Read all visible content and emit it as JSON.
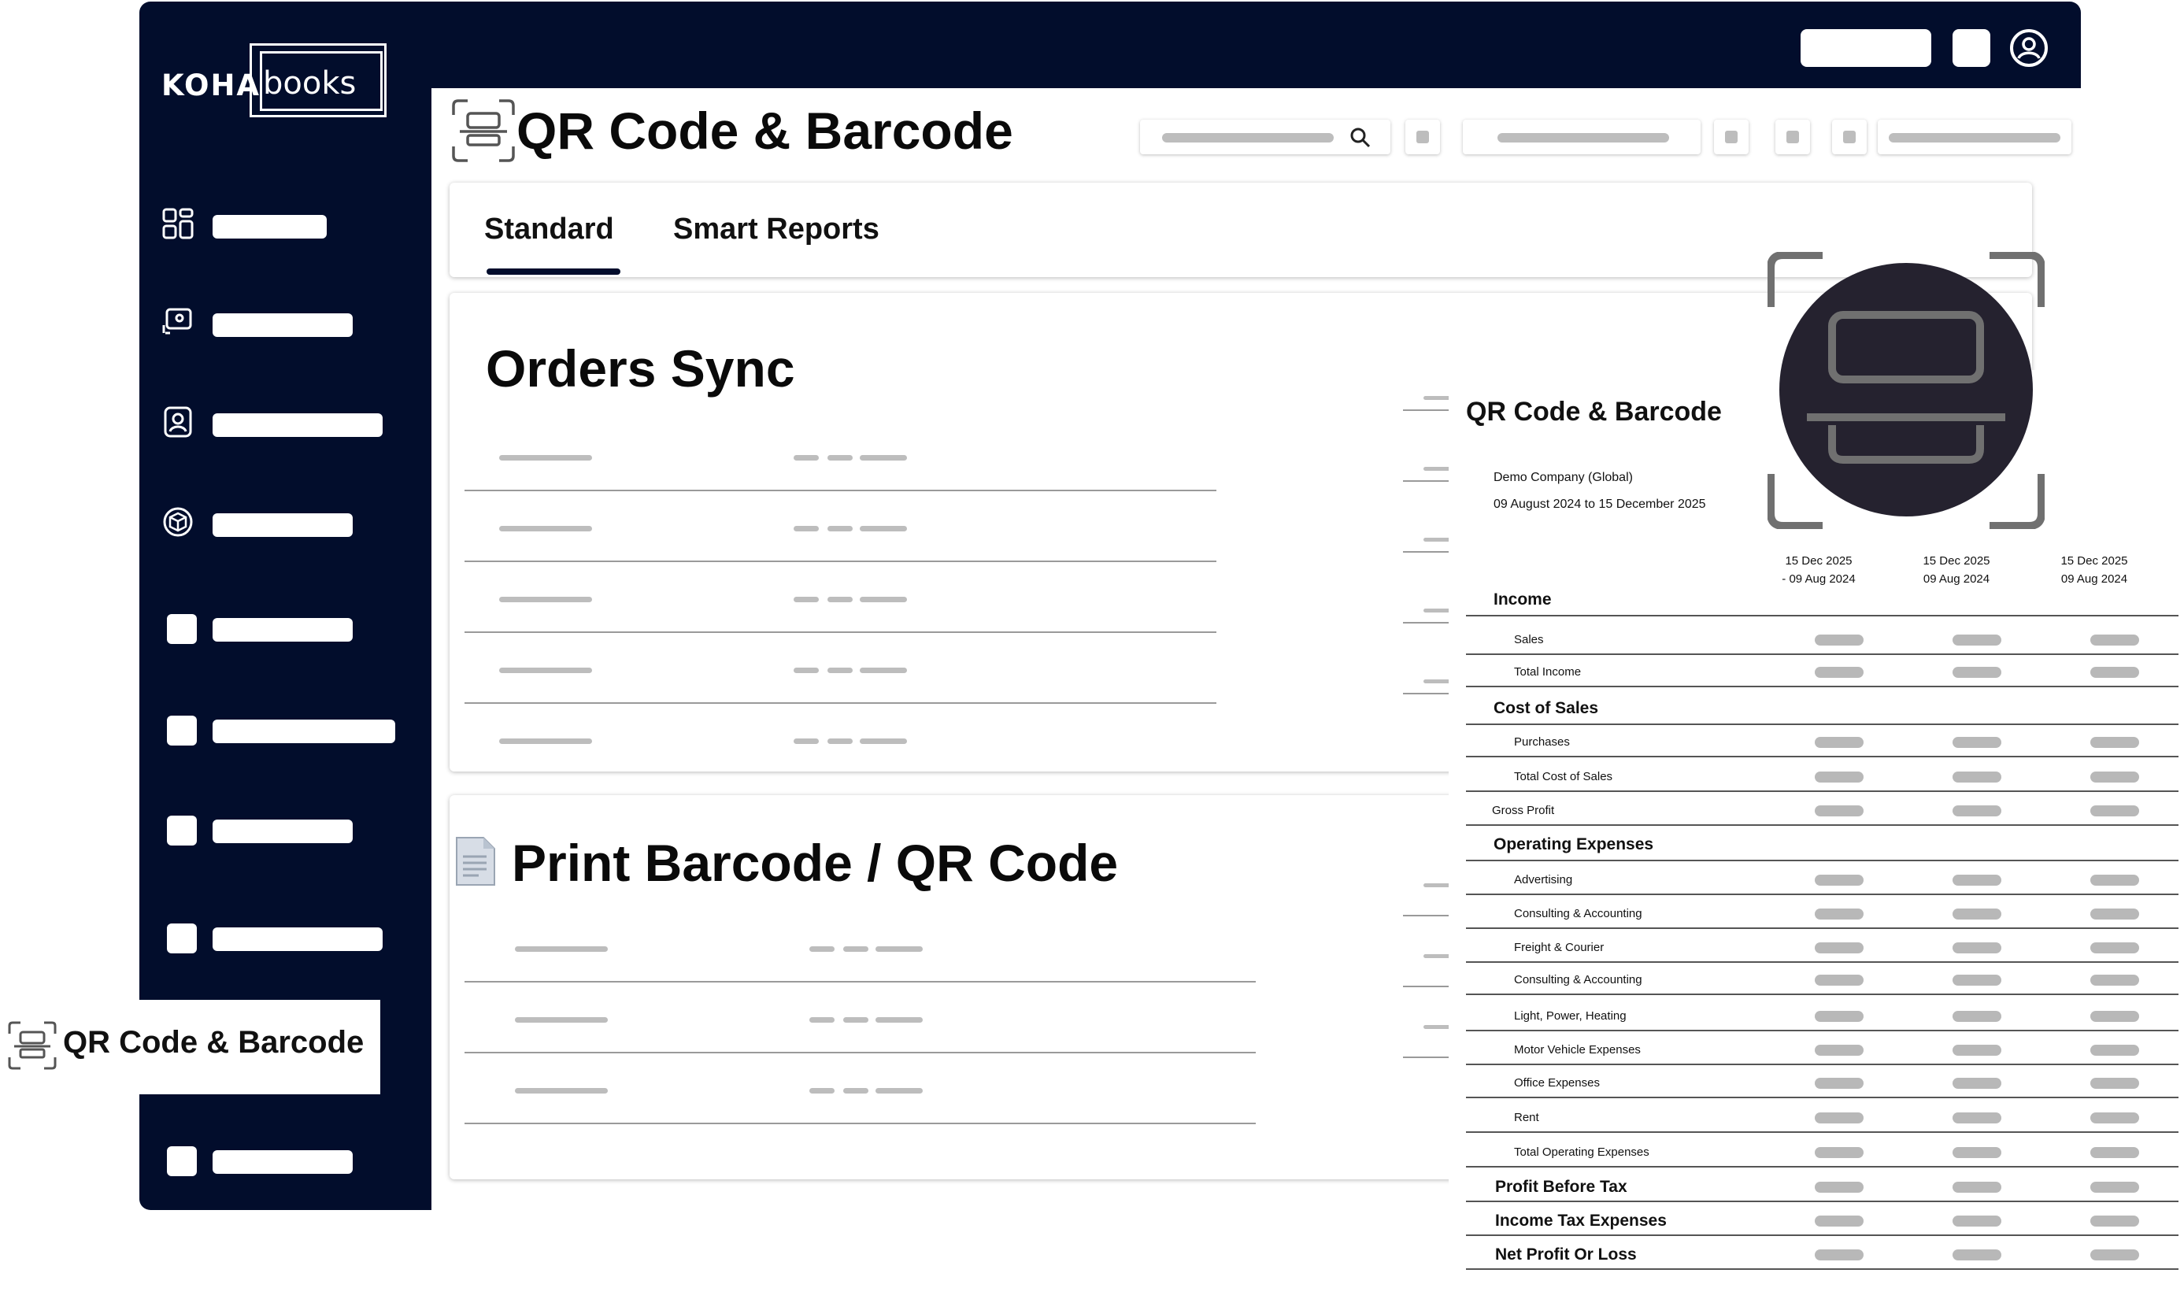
{
  "brand": {
    "logo_left": "KOHA",
    "logo_right": "books"
  },
  "header": {
    "page_title": "QR Code & Barcode"
  },
  "tabs": [
    {
      "label": "Standard",
      "active": true
    },
    {
      "label": "Smart Reports",
      "active": false
    }
  ],
  "sections": {
    "orders_sync": {
      "title": "Orders Sync"
    },
    "print_barcode": {
      "title": "Print Barcode / QR Code"
    }
  },
  "sidebar": {
    "active_label": "QR Code & Barcode"
  },
  "report": {
    "title": "QR Code & Barcode",
    "company": "Demo Company (Global)",
    "period": "09 August 2024 to 15 December 2025",
    "columns": [
      {
        "line1": "15 Dec 2025",
        "line2": "- 09 Aug 2024"
      },
      {
        "line1": "15 Dec 2025",
        "line2": "09 Aug 2024"
      },
      {
        "line1": "15 Dec 2025",
        "line2": "09 Aug 2024"
      }
    ],
    "rows": [
      {
        "label": "Income",
        "kind": "heading"
      },
      {
        "label": "Sales",
        "kind": "item"
      },
      {
        "label": "Total Income",
        "kind": "item"
      },
      {
        "label": "Cost of Sales",
        "kind": "heading"
      },
      {
        "label": "Purchases",
        "kind": "item"
      },
      {
        "label": "Total Cost of Sales",
        "kind": "item"
      },
      {
        "label": "Gross Profit",
        "kind": "plain"
      },
      {
        "label": "Operating Expenses",
        "kind": "heading"
      },
      {
        "label": "Advertising",
        "kind": "item"
      },
      {
        "label": "Consulting & Accounting",
        "kind": "item"
      },
      {
        "label": "Freight & Courier",
        "kind": "item"
      },
      {
        "label": "Consulting & Accounting",
        "kind": "item"
      },
      {
        "label": "Light, Power, Heating",
        "kind": "item"
      },
      {
        "label": "Motor Vehicle Expenses",
        "kind": "item"
      },
      {
        "label": "Office Expenses",
        "kind": "item"
      },
      {
        "label": "Rent",
        "kind": "item"
      },
      {
        "label": "Total Operating Expenses",
        "kind": "item"
      },
      {
        "label": "Profit Before Tax",
        "kind": "total"
      },
      {
        "label": "Income Tax Expenses",
        "kind": "total"
      },
      {
        "label": "Net Profit Or Loss",
        "kind": "total"
      }
    ]
  },
  "icons": {
    "sidebar": [
      "dashboard-icon",
      "customer-support-icon",
      "contact-card-icon",
      "package-icon"
    ],
    "title": "qr-scan-icon",
    "search": "search-icon",
    "section": "document-icon",
    "account": "user-icon"
  },
  "colors": {
    "navy": "#020d2c",
    "qr_badge": "#25222f",
    "placeholder": "#bdbdbd"
  }
}
